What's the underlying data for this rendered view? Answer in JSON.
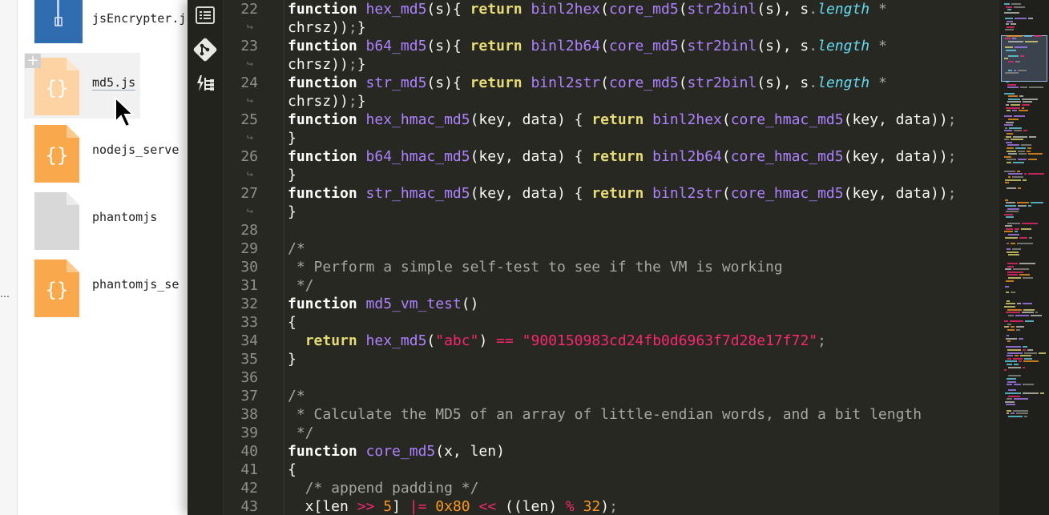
{
  "file_browser": {
    "items": [
      {
        "name": "jsEncrypter.j",
        "icon": "zip-file-icon",
        "selected": false
      },
      {
        "name": "md5.js",
        "icon": "js-file-icon",
        "selected": true
      },
      {
        "name": "nodejs_serve",
        "icon": "js-file-icon",
        "selected": false
      },
      {
        "name": "phantomjs",
        "icon": "generic-file-icon",
        "selected": false
      },
      {
        "name": "phantomjs_se",
        "icon": "js-file-icon",
        "selected": false
      }
    ],
    "add_label": "+",
    "ellipsis": "…"
  },
  "editor": {
    "sidebar_icons": [
      "outline-icon",
      "git-icon",
      "structure-icon"
    ],
    "lines": [
      {
        "num": "22",
        "wrap": "↪",
        "tokens": [
          [
            "kw",
            "function "
          ],
          [
            "fn",
            "hex_md5"
          ],
          [
            "pa",
            "(s){ "
          ],
          [
            "ret",
            "return "
          ],
          [
            "fx",
            "binl2hex"
          ],
          [
            "pa",
            "("
          ],
          [
            "fx",
            "core_md5"
          ],
          [
            "pa",
            "("
          ],
          [
            "fx",
            "str2binl"
          ],
          [
            "pa",
            "(s), s"
          ],
          [
            "muted",
            "."
          ],
          [
            "prop",
            "length"
          ],
          [
            "muted",
            " *"
          ]
        ],
        "cont": [
          [
            "pa",
            "chrsz))"
          ],
          [
            "muted",
            ";"
          ],
          [
            "pa",
            "}"
          ]
        ]
      },
      {
        "num": "23",
        "wrap": "↪",
        "tokens": [
          [
            "kw",
            "function "
          ],
          [
            "fn",
            "b64_md5"
          ],
          [
            "pa",
            "(s){ "
          ],
          [
            "ret",
            "return "
          ],
          [
            "fx",
            "binl2b64"
          ],
          [
            "pa",
            "("
          ],
          [
            "fx",
            "core_md5"
          ],
          [
            "pa",
            "("
          ],
          [
            "fx",
            "str2binl"
          ],
          [
            "pa",
            "(s), s"
          ],
          [
            "muted",
            "."
          ],
          [
            "prop",
            "length"
          ],
          [
            "muted",
            " *"
          ]
        ],
        "cont": [
          [
            "pa",
            "chrsz))"
          ],
          [
            "muted",
            ";"
          ],
          [
            "pa",
            "}"
          ]
        ]
      },
      {
        "num": "24",
        "wrap": "↪",
        "tokens": [
          [
            "kw",
            "function "
          ],
          [
            "fn",
            "str_md5"
          ],
          [
            "pa",
            "(s){ "
          ],
          [
            "ret",
            "return "
          ],
          [
            "fx",
            "binl2str"
          ],
          [
            "pa",
            "("
          ],
          [
            "fx",
            "core_md5"
          ],
          [
            "pa",
            "("
          ],
          [
            "fx",
            "str2binl"
          ],
          [
            "pa",
            "(s), s"
          ],
          [
            "muted",
            "."
          ],
          [
            "prop",
            "length"
          ],
          [
            "muted",
            " *"
          ]
        ],
        "cont": [
          [
            "pa",
            "chrsz))"
          ],
          [
            "muted",
            ";"
          ],
          [
            "pa",
            "}"
          ]
        ]
      },
      {
        "num": "25",
        "wrap": "↪",
        "tokens": [
          [
            "kw",
            "function "
          ],
          [
            "fn",
            "hex_hmac_md5"
          ],
          [
            "pa",
            "(key, data) { "
          ],
          [
            "ret",
            "return "
          ],
          [
            "fx",
            "binl2hex"
          ],
          [
            "pa",
            "("
          ],
          [
            "fx",
            "core_hmac_md5"
          ],
          [
            "pa",
            "(key, data))"
          ],
          [
            "muted",
            ";"
          ]
        ],
        "cont": [
          [
            "pa",
            "}"
          ]
        ]
      },
      {
        "num": "26",
        "wrap": "↪",
        "tokens": [
          [
            "kw",
            "function "
          ],
          [
            "fn",
            "b64_hmac_md5"
          ],
          [
            "pa",
            "(key, data) { "
          ],
          [
            "ret",
            "return "
          ],
          [
            "fx",
            "binl2b64"
          ],
          [
            "pa",
            "("
          ],
          [
            "fx",
            "core_hmac_md5"
          ],
          [
            "pa",
            "(key, data))"
          ],
          [
            "muted",
            ";"
          ]
        ],
        "cont": [
          [
            "pa",
            "}"
          ]
        ]
      },
      {
        "num": "27",
        "wrap": "↪",
        "tokens": [
          [
            "kw",
            "function "
          ],
          [
            "fn",
            "str_hmac_md5"
          ],
          [
            "pa",
            "(key, data) { "
          ],
          [
            "ret",
            "return "
          ],
          [
            "fx",
            "binl2str"
          ],
          [
            "pa",
            "("
          ],
          [
            "fx",
            "core_hmac_md5"
          ],
          [
            "pa",
            "(key, data))"
          ],
          [
            "muted",
            ";"
          ]
        ],
        "cont": [
          [
            "pa",
            "}"
          ]
        ]
      },
      {
        "num": "28",
        "tokens": []
      },
      {
        "num": "29",
        "tokens": [
          [
            "cm",
            "/*"
          ]
        ]
      },
      {
        "num": "30",
        "tokens": [
          [
            "cm",
            " * Perform a simple self-test to see if the VM is working"
          ]
        ]
      },
      {
        "num": "31",
        "tokens": [
          [
            "cm",
            " */"
          ]
        ]
      },
      {
        "num": "32",
        "tokens": [
          [
            "kw",
            "function "
          ],
          [
            "fn",
            "md5_vm_test"
          ],
          [
            "pa",
            "()"
          ]
        ]
      },
      {
        "num": "33",
        "tokens": [
          [
            "pa",
            "{"
          ]
        ]
      },
      {
        "num": "34",
        "tokens": [
          [
            "pa",
            "  "
          ],
          [
            "ret",
            "return "
          ],
          [
            "fx",
            "hex_md5"
          ],
          [
            "pa",
            "("
          ],
          [
            "str",
            "\"abc\""
          ],
          [
            "pa",
            ") "
          ],
          [
            "op",
            "=="
          ],
          [
            "pa",
            " "
          ],
          [
            "str",
            "\"900150983cd24fb0d6963f7d28e17f72\""
          ],
          [
            "muted",
            ";"
          ]
        ]
      },
      {
        "num": "35",
        "tokens": [
          [
            "pa",
            "}"
          ]
        ]
      },
      {
        "num": "36",
        "tokens": []
      },
      {
        "num": "37",
        "tokens": [
          [
            "cm",
            "/*"
          ]
        ]
      },
      {
        "num": "38",
        "tokens": [
          [
            "cm",
            " * Calculate the MD5 of an array of little-endian words, and a bit length"
          ]
        ]
      },
      {
        "num": "39",
        "tokens": [
          [
            "cm",
            " */"
          ]
        ]
      },
      {
        "num": "40",
        "tokens": [
          [
            "kw",
            "function "
          ],
          [
            "fn",
            "core_md5"
          ],
          [
            "pa",
            "(x, len)"
          ]
        ]
      },
      {
        "num": "41",
        "tokens": [
          [
            "pa",
            "{"
          ]
        ]
      },
      {
        "num": "42",
        "tokens": [
          [
            "cm",
            "  /* append padding */"
          ]
        ]
      },
      {
        "num": "43",
        "tokens": [
          [
            "pa",
            "  x[len "
          ],
          [
            "op",
            ">>"
          ],
          [
            "pa",
            " "
          ],
          [
            "num",
            "5"
          ],
          [
            "pa",
            "] "
          ],
          [
            "op",
            "|="
          ],
          [
            "pa",
            " "
          ],
          [
            "num",
            "0x80"
          ],
          [
            "pa",
            " "
          ],
          [
            "op",
            "<<"
          ],
          [
            "pa",
            " ((len) "
          ],
          [
            "op",
            "%"
          ],
          [
            "pa",
            " "
          ],
          [
            "num",
            "32"
          ],
          [
            "pa",
            ")"
          ],
          [
            "muted",
            ";"
          ]
        ]
      }
    ]
  },
  "colors": {
    "editor_bg": "#272822",
    "keyword": "#ffffff",
    "return": "#e6db74",
    "function": "#ae81ff",
    "property": "#66d9ef",
    "string": "#f92672",
    "number": "#fd971f",
    "comment": "#a6a6a0",
    "js_file": "#f9a94b",
    "zip_file": "#2f6db0"
  }
}
